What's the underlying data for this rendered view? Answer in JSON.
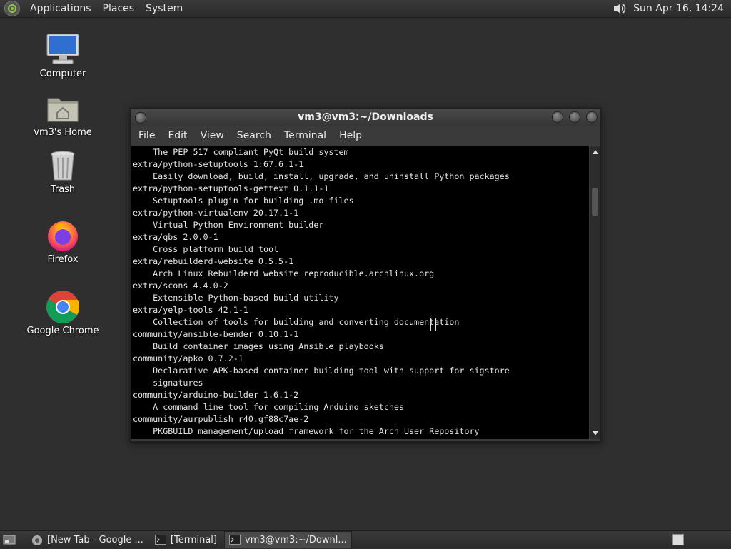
{
  "top_panel": {
    "menus": [
      "Applications",
      "Places",
      "System"
    ],
    "clock": "Sun Apr 16, 14:24",
    "icons": {
      "logo": "distro-logo-icon",
      "volume": "volume-icon"
    }
  },
  "desktop": {
    "icons": [
      {
        "label": "Computer",
        "icon": "computer-icon"
      },
      {
        "label": "vm3's Home",
        "icon": "home-folder-icon"
      },
      {
        "label": "Trash",
        "icon": "trash-icon"
      },
      {
        "label": "Firefox",
        "icon": "firefox-icon"
      },
      {
        "label": "Google Chrome",
        "icon": "chrome-icon"
      }
    ]
  },
  "window": {
    "title": "vm3@vm3:~/Downloads",
    "menu": [
      "File",
      "Edit",
      "View",
      "Search",
      "Terminal",
      "Help"
    ],
    "terminal_lines": [
      "    The PEP 517 compliant PyQt build system",
      "extra/python-setuptools 1:67.6.1-1",
      "    Easily download, build, install, upgrade, and uninstall Python packages",
      "extra/python-setuptools-gettext 0.1.1-1",
      "    Setuptools plugin for building .mo files",
      "extra/python-virtualenv 20.17.1-1",
      "    Virtual Python Environment builder",
      "extra/qbs 2.0.0-1",
      "    Cross platform build tool",
      "extra/rebuilderd-website 0.5.5-1",
      "    Arch Linux Rebuilderd website reproducible.archlinux.org",
      "extra/scons 4.4.0-2",
      "    Extensible Python-based build utility",
      "extra/yelp-tools 42.1-1",
      "    Collection of tools for building and converting documentation",
      "community/ansible-bender 0.10.1-1",
      "    Build container images using Ansible playbooks",
      "community/apko 0.7.2-1",
      "    Declarative APK-based container building tool with support for sigstore",
      "    signatures",
      "community/arduino-builder 1.6.1-2",
      "    A command line tool for compiling Arduino sketches",
      "community/aurpublish r40.gf88c7ae-2",
      "    PKGBUILD management/upload framework for the Arch User Repository"
    ]
  },
  "taskbar": {
    "tasks": [
      {
        "label": "[New Tab - Google ...",
        "icon": "chrome-icon",
        "active": false
      },
      {
        "label": "[Terminal]",
        "icon": "terminal-icon",
        "active": false
      },
      {
        "label": "vm3@vm3:~/Downl...",
        "icon": "terminal-icon",
        "active": true
      }
    ]
  },
  "colors": {
    "desktop_bg": "#2f2f2f",
    "terminal_bg": "#000000",
    "terminal_fg": "#e6e6e6"
  }
}
